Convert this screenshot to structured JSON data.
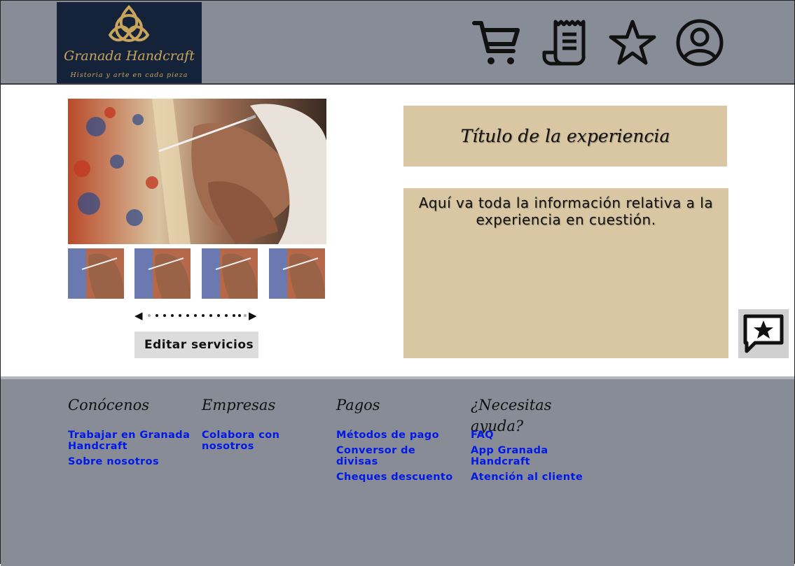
{
  "header": {
    "logo_title": "Granada Handcraft",
    "logo_subtitle": "Historia y arte en cada pieza",
    "icons": [
      "cart-icon",
      "receipt-icon",
      "star-icon",
      "user-icon"
    ]
  },
  "gallery": {
    "thumb_count": 4,
    "carousel": {
      "prev": "◀",
      "next": "▶",
      "dot_count": 14
    },
    "edit_button": "Editar servicios"
  },
  "experience": {
    "title": "Título de la experiencia",
    "info": "Aquí va toda la información relativa a la experiencia en cuestión."
  },
  "review_button_icon": "star-comment-icon",
  "footer": {
    "columns": [
      {
        "heading": "Conócenos",
        "links": [
          "Trabajar en Granada Handcraft",
          "Sobre nosotros"
        ]
      },
      {
        "heading": "Empresas",
        "links": [
          "Colabora con nosotros"
        ]
      },
      {
        "heading": "Pagos",
        "links": [
          "Métodos de pago",
          "Conversor de divisas",
          "Cheques descuento"
        ]
      },
      {
        "heading": "¿Necesitas ayuda?",
        "links": [
          "FAQ",
          "App Granada Handcraft",
          "Atención al cliente"
        ]
      }
    ]
  },
  "colors": {
    "header_bg": "#878c96",
    "logo_bg": "#14223a",
    "logo_gold": "#c9a45c",
    "panel_bg": "#d8c7a2",
    "link": "#0018e8"
  }
}
